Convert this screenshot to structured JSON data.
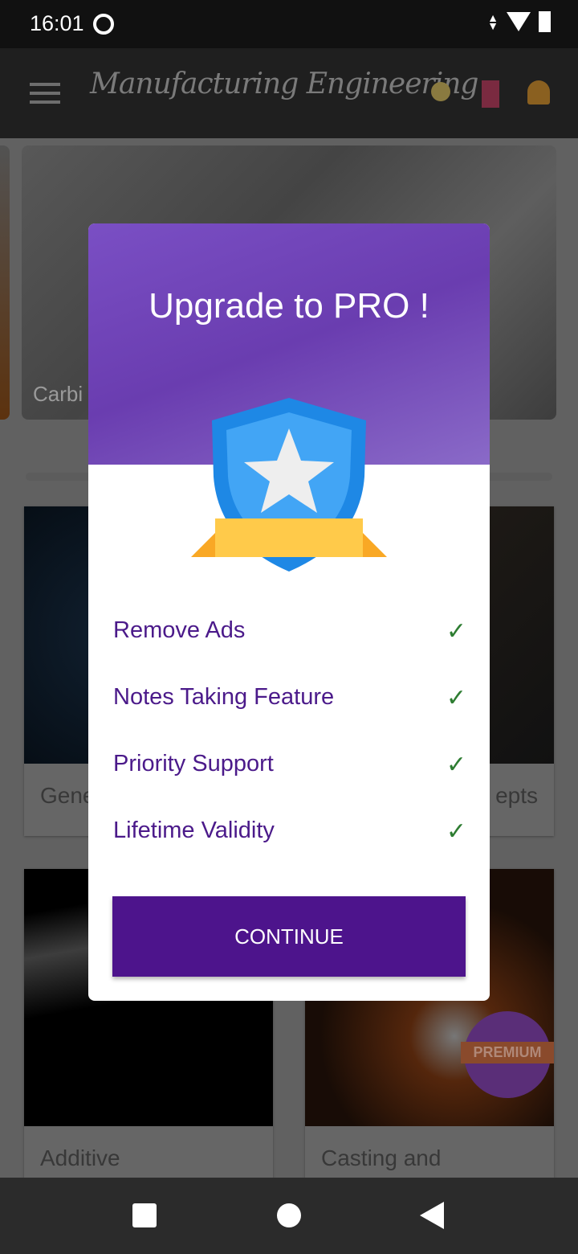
{
  "status_bar": {
    "time": "16:01"
  },
  "app_bar": {
    "title": "Manufacturing Engineering",
    "icons": [
      "menu-icon",
      "search-icon",
      "bookmark-icon",
      "bell-icon"
    ]
  },
  "banner": {
    "caption": "Carbi"
  },
  "cards": [
    {
      "label": "Gene"
    },
    {
      "label": "epts"
    },
    {
      "label": "Additive"
    },
    {
      "label": "Casting and"
    }
  ],
  "premium_badge": "PREMIUM",
  "dialog": {
    "title": "Upgrade to PRO !",
    "features": [
      "Remove Ads",
      "Notes Taking Feature",
      "Priority Support",
      "Lifetime Validity"
    ],
    "button": "CONTINUE",
    "colors": {
      "accent": "#4d148c",
      "check": "#2e7d32"
    }
  }
}
